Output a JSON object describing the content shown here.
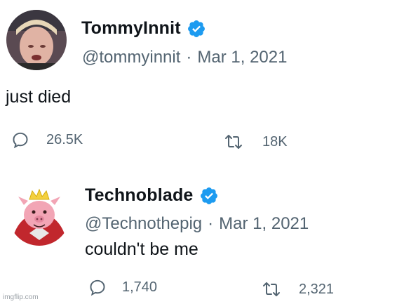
{
  "tweets": [
    {
      "display_name": "TommyInnit",
      "handle": "@tommyinnit",
      "date": "Mar 1, 2021",
      "text": "just died",
      "replies": "26.5K",
      "retweets": "18K"
    },
    {
      "display_name": "Technoblade",
      "handle": "@Technothepig",
      "date": "Mar 1, 2021",
      "text": "couldn't be me",
      "replies": "1,740",
      "retweets": "2,321"
    }
  ],
  "separator": "·",
  "watermark": "imgflip.com",
  "colors": {
    "verified_badge": "#1d9bf0",
    "text_primary": "#0f1419",
    "text_secondary": "#536471"
  },
  "icons": {
    "verified": "verified-badge-icon",
    "reply": "reply-icon",
    "retweet": "retweet-icon"
  }
}
